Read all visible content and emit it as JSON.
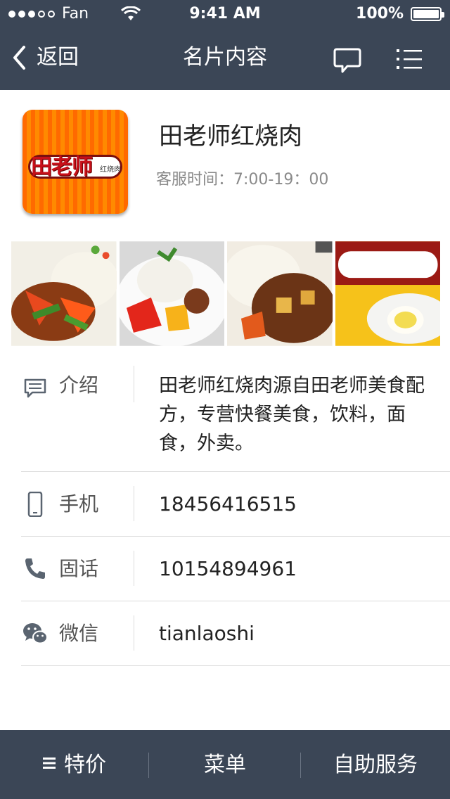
{
  "status_bar": {
    "carrier": "Fan",
    "time": "9:41 AM",
    "battery": "100%",
    "signal_bars_filled": 3,
    "signal_bars_total": 5
  },
  "nav": {
    "back_label": "返回",
    "title": "名片内容",
    "chat_icon": "chat-bubble-icon",
    "menu_icon": "list-menu-icon"
  },
  "profile": {
    "logo_text": "田老师",
    "logo_subtext": "红烧肉",
    "name": "田老师红烧肉",
    "service_hours": "客服时间：7:00-19：00"
  },
  "photos": [
    {
      "name": "dish-photo-1",
      "icon": "food-photo"
    },
    {
      "name": "dish-photo-2",
      "icon": "food-photo"
    },
    {
      "name": "dish-photo-3",
      "icon": "food-photo"
    },
    {
      "name": "dish-photo-4",
      "icon": "food-photo"
    }
  ],
  "info": {
    "intro": {
      "label": "介绍",
      "icon": "message-lines-icon",
      "value": "田老师红烧肉源自田老师美食配方，专营快餐美食，饮料，面食，外卖。"
    },
    "mobile": {
      "label": "手机",
      "icon": "mobile-phone-icon",
      "value": "18456416515"
    },
    "landline": {
      "label": "固话",
      "icon": "telephone-handset-icon",
      "value": "10154894961"
    },
    "wechat": {
      "label": "微信",
      "icon": "wechat-icon",
      "value": "tianlaoshi"
    }
  },
  "tabbar": {
    "special": "特价",
    "menu": "菜单",
    "self_service": "自助服务"
  },
  "colors": {
    "header_bg": "#3b4656",
    "text_primary": "#222222",
    "text_secondary": "#8a8a8a",
    "logo_orange": "#ff6a00",
    "logo_red": "#c8101a"
  }
}
